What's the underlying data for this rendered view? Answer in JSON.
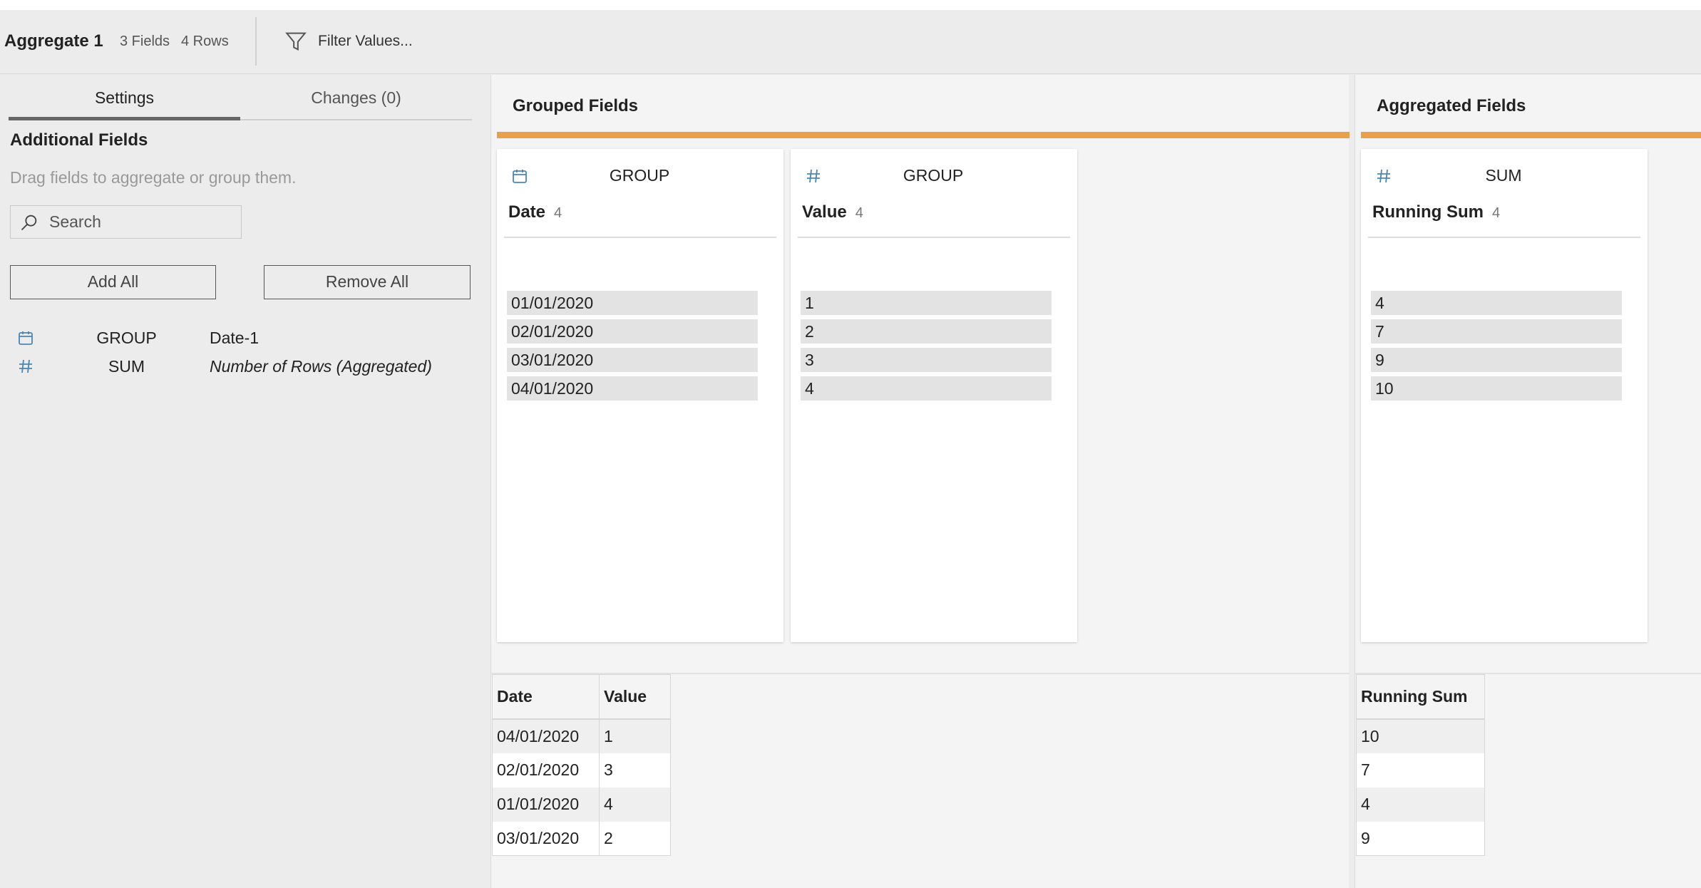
{
  "topbar": {
    "title": "Aggregate 1",
    "fields_count": "3 Fields",
    "rows_count": "4 Rows",
    "filter_label": "Filter Values..."
  },
  "left_panel": {
    "tabs": [
      {
        "label": "Settings",
        "active": true
      },
      {
        "label": "Changes (0)",
        "active": false
      }
    ],
    "heading": "Additional Fields",
    "hint": "Drag fields to aggregate or group them.",
    "search_placeholder": "Search",
    "add_all_label": "Add All",
    "remove_all_label": "Remove All",
    "fields": [
      {
        "icon": "calendar-icon",
        "aggregation": "GROUP",
        "name": "Date-1"
      },
      {
        "icon": "number-icon",
        "aggregation": "SUM",
        "name": "Number of Rows (Aggregated)"
      }
    ]
  },
  "grouped_fields": {
    "title": "Grouped Fields",
    "cards": [
      {
        "icon": "calendar-icon",
        "aggregation": "GROUP",
        "name": "Date",
        "count": "4",
        "values": [
          "01/01/2020",
          "02/01/2020",
          "03/01/2020",
          "04/01/2020"
        ]
      },
      {
        "icon": "number-icon",
        "aggregation": "GROUP",
        "name": "Value",
        "count": "4",
        "values": [
          "1",
          "2",
          "3",
          "4"
        ]
      }
    ],
    "table": {
      "columns": [
        "Date",
        "Value"
      ],
      "rows": [
        [
          "04/01/2020",
          "1"
        ],
        [
          "02/01/2020",
          "3"
        ],
        [
          "01/01/2020",
          "4"
        ],
        [
          "03/01/2020",
          "2"
        ]
      ]
    }
  },
  "aggregated_fields": {
    "title": "Aggregated Fields",
    "cards": [
      {
        "icon": "number-icon",
        "aggregation": "SUM",
        "name": "Running Sum",
        "count": "4",
        "values": [
          "4",
          "7",
          "9",
          "10"
        ]
      }
    ],
    "table": {
      "columns": [
        "Running Sum"
      ],
      "rows": [
        [
          "10"
        ],
        [
          "7"
        ],
        [
          "4"
        ],
        [
          "9"
        ]
      ]
    }
  },
  "colors": {
    "accent_orange": "#e8a04c",
    "icon_blue": "#4a86b4"
  }
}
